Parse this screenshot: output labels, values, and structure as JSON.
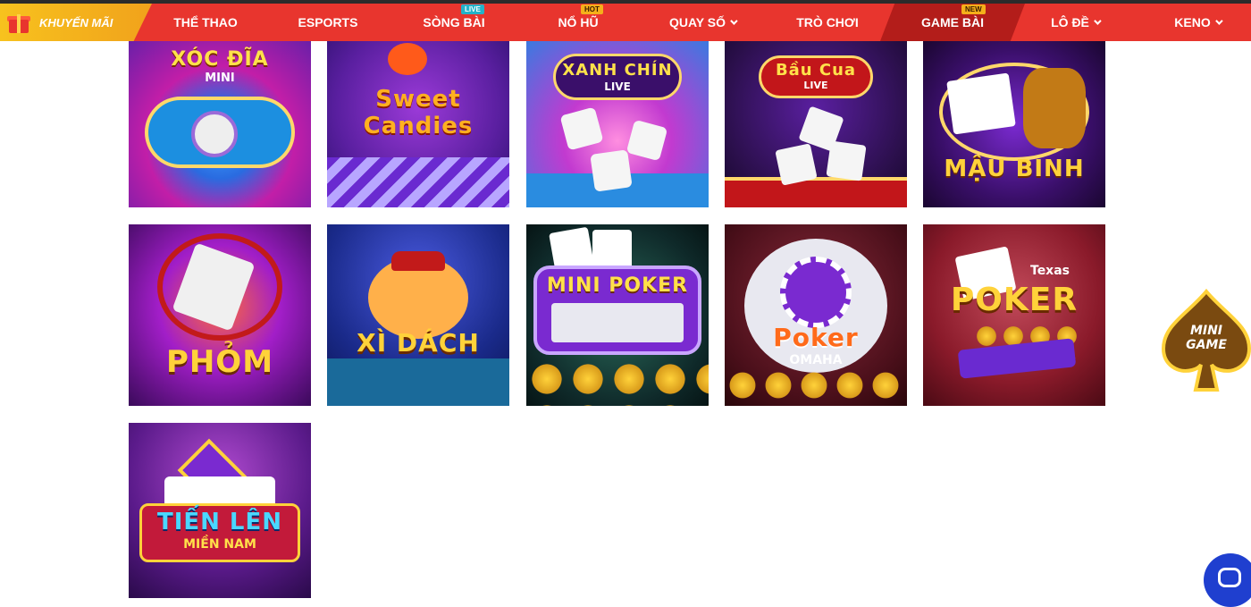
{
  "nav": {
    "promo": "KHUYẾN MÃI",
    "items": [
      {
        "label": "THỂ THAO",
        "badge": ""
      },
      {
        "label": "ESPORTS",
        "badge": ""
      },
      {
        "label": "SÒNG BÀI",
        "badge": "LIVE"
      },
      {
        "label": "NỔ HŨ",
        "badge": "HOT"
      },
      {
        "label": "QUAY SỐ",
        "badge": ""
      },
      {
        "label": "TRÒ CHƠI",
        "badge": ""
      },
      {
        "label": "GAME BÀI",
        "badge": "NEW"
      },
      {
        "label": "LÔ ĐỀ",
        "badge": ""
      },
      {
        "label": "KENO",
        "badge": ""
      }
    ]
  },
  "games": [
    {
      "title": "XÓC ĐĨA",
      "sub": "MINI"
    },
    {
      "title": "Sweet Candies",
      "sub": ""
    },
    {
      "title": "XANH CHÍN",
      "sub": "LIVE"
    },
    {
      "title": "Bầu Cua",
      "sub": "LIVE"
    },
    {
      "title": "MẬU BINH",
      "sub": ""
    },
    {
      "title": "PHỎM",
      "sub": ""
    },
    {
      "title": "XÌ DÁCH",
      "sub": ""
    },
    {
      "title": "MINI POKER",
      "sub": ""
    },
    {
      "title": "Poker",
      "sub": "OMAHA"
    },
    {
      "title": "POKER",
      "sub": "Texas"
    },
    {
      "title": "TIẾN LÊN",
      "sub": "MIỀN NAM"
    }
  ],
  "widget": {
    "title": "MINI",
    "sub": "GAME"
  }
}
